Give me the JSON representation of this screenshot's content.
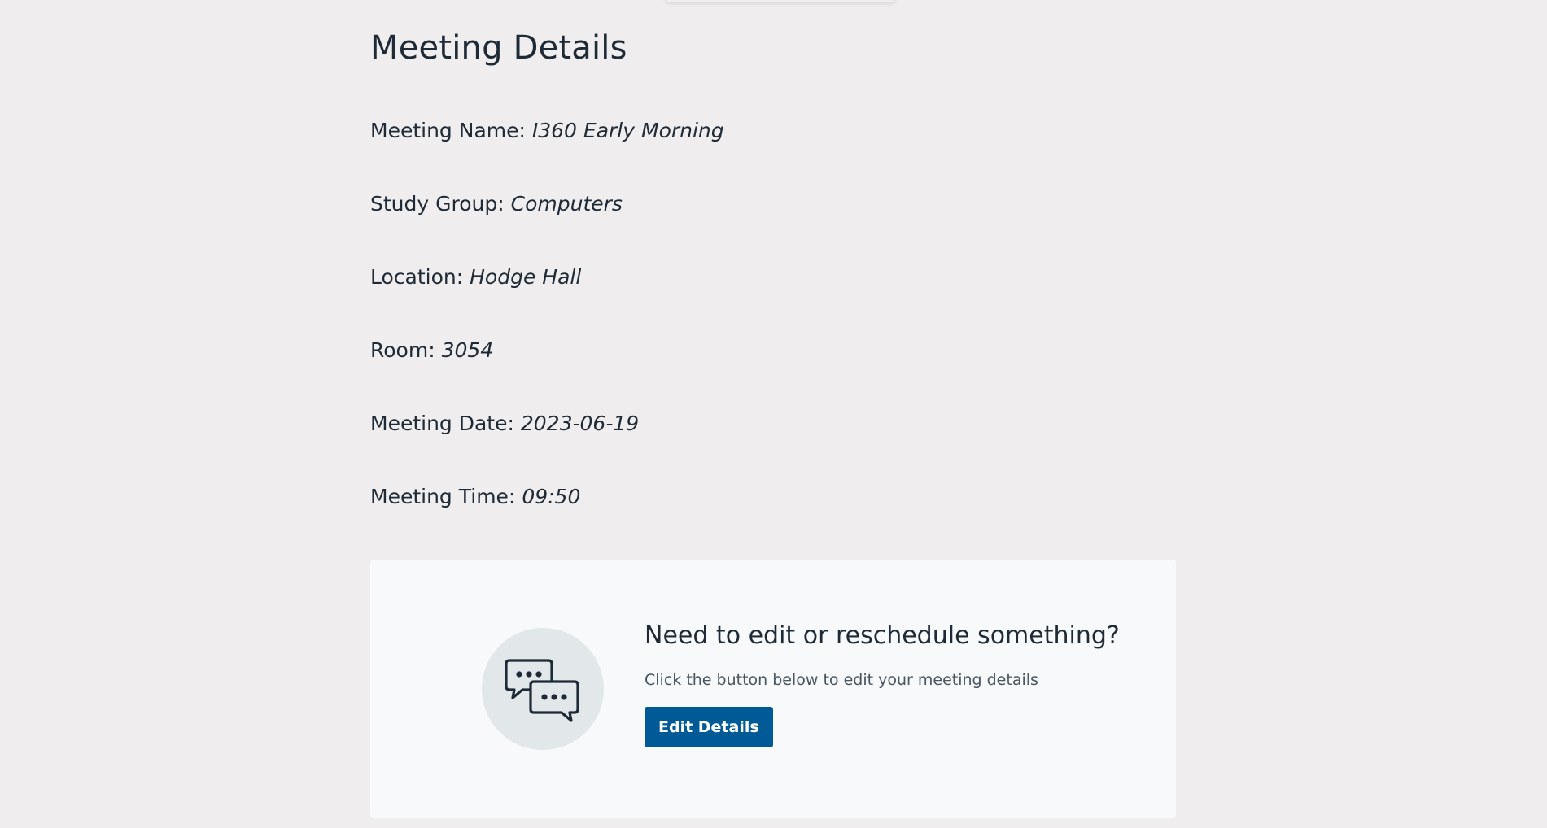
{
  "page": {
    "title": "Meeting Details"
  },
  "details": [
    {
      "label": "Meeting Name:",
      "value": "I360 Early Morning"
    },
    {
      "label": "Study Group:",
      "value": "Computers"
    },
    {
      "label": "Location:",
      "value": "Hodge Hall"
    },
    {
      "label": "Room:",
      "value": "3054"
    },
    {
      "label": "Meeting Date:",
      "value": "2023-06-19"
    },
    {
      "label": "Meeting Time:",
      "value": "09:50"
    }
  ],
  "edit_card": {
    "icon": "chat-bubbles-icon",
    "heading": "Need to edit or reschedule something?",
    "description": "Click the button below to edit your meeting details",
    "button_label": "Edit Details"
  },
  "colors": {
    "background": "#efeded",
    "card_background": "#f7f9fa",
    "icon_circle": "#e2e7e9",
    "primary_button": "#005a96",
    "text": "#1f2a37"
  }
}
